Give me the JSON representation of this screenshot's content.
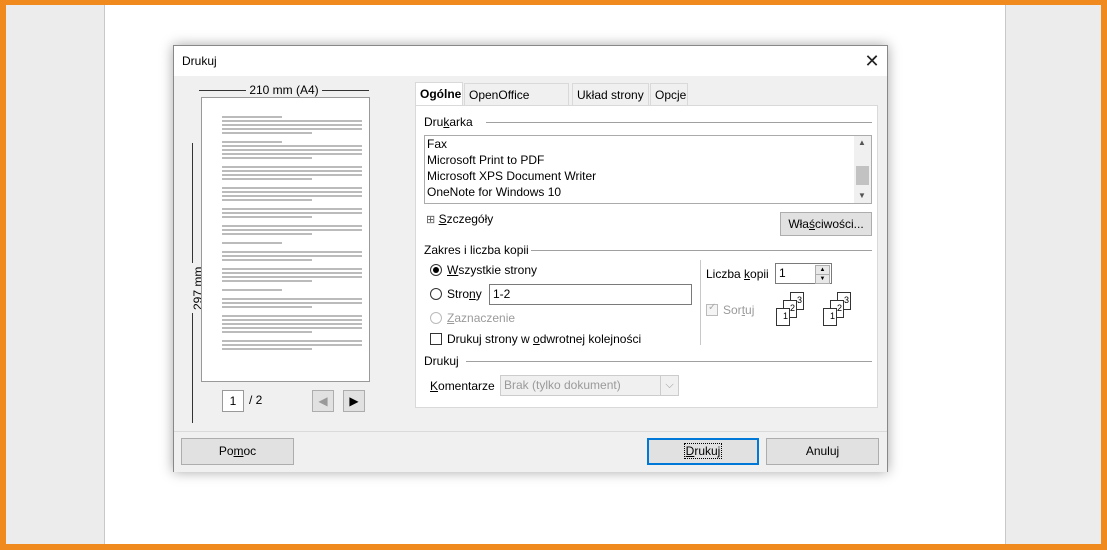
{
  "dialog": {
    "title": "Drukuj",
    "close_glyph": "✕"
  },
  "preview": {
    "width_label": "210 mm (A4)",
    "height_label": "297 mm",
    "current_page": "1",
    "total_pages": "/ 2",
    "prev_glyph": "◀",
    "next_glyph": "▶"
  },
  "tabs": [
    {
      "label": "Ogólne"
    },
    {
      "label": "OpenOffice Writer"
    },
    {
      "label": "Układ strony"
    },
    {
      "label": "Opcje"
    }
  ],
  "printer": {
    "section_label_pre": "Dru",
    "section_label_u": "k",
    "section_label_post": "arka",
    "items": [
      "Fax",
      "Microsoft Print to PDF",
      "Microsoft XPS Document Writer",
      "OneNote for Windows 10"
    ],
    "details_glyph": "⊞",
    "details_u": "S",
    "details_label": "zczegóły",
    "properties_pre": "Wła",
    "properties_u": "ś",
    "properties_post": "ciwości..."
  },
  "range": {
    "section_label": "Zakres i liczba kopii",
    "all_pages_u": "W",
    "all_pages_rest": "szystkie strony",
    "pages_pre": "Stro",
    "pages_u": "n",
    "pages_post": "y",
    "pages_value": "1-2",
    "selection_u": "Z",
    "selection_rest": "aznaczenie",
    "reverse_pre": "Drukuj strony w ",
    "reverse_u": "o",
    "reverse_post": "dwrotnej kolejności",
    "copies_pre": "Liczba ",
    "copies_u": "k",
    "copies_post": "opii",
    "copies_value": "1",
    "collate_pre": "Sor",
    "collate_u": "t",
    "collate_post": "uj",
    "spin_up": "▲",
    "spin_down": "▼"
  },
  "print_section": {
    "label": "Drukuj",
    "comments_u": "K",
    "comments_rest": "omentarze",
    "comments_value": "Brak (tylko dokument)",
    "dropdown_glyph": "⌵"
  },
  "buttons": {
    "help_pre": "Po",
    "help_u": "m",
    "help_post": "oc",
    "print_u": "D",
    "print_rest": "rukuj",
    "cancel": "Anuluj"
  },
  "copy_icons": {
    "digits": [
      "1",
      "2",
      "3"
    ]
  }
}
